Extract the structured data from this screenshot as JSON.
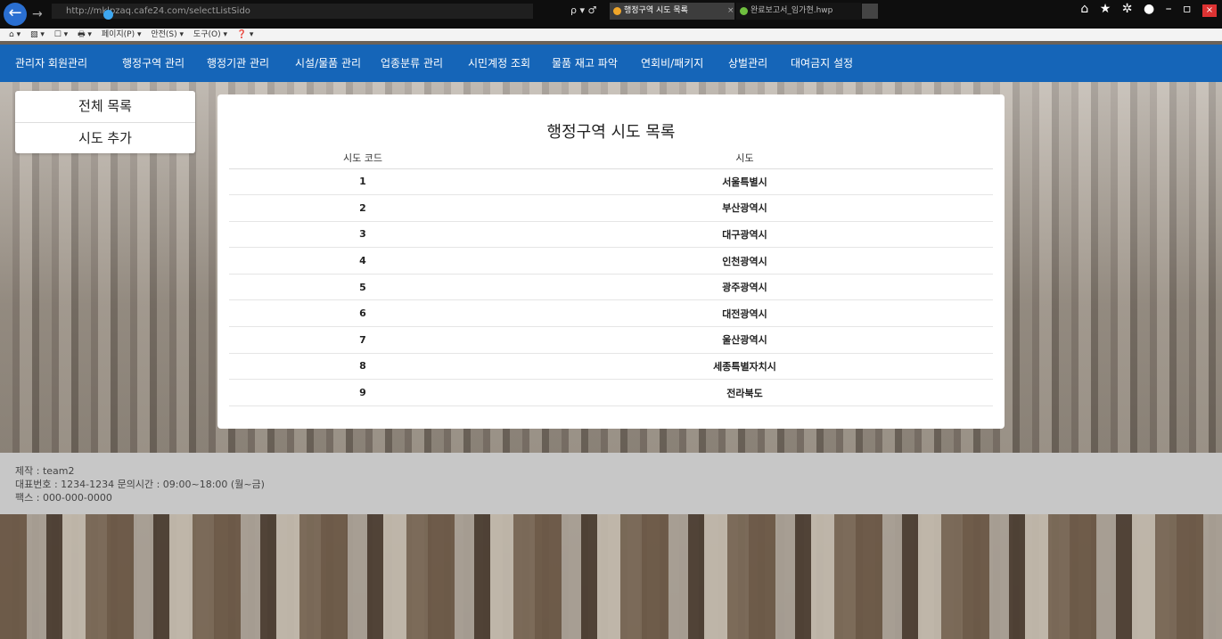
{
  "browser": {
    "url": "http://mklpzaq.cafe24.com/selectListSido",
    "addr_tools": "ρ ▾ ♂",
    "tabs": [
      {
        "label": "행정구역 시도 목록",
        "close": "×"
      },
      {
        "label": "완료보고서_임가현.hwp",
        "close": ""
      }
    ],
    "cmdbar": [
      "⌂ ▾",
      "▧ ▾",
      "☐ ▾",
      "🖶 ▾",
      "페이지(P) ▾",
      "안전(S) ▾",
      "도구(O) ▾",
      "❓ ▾"
    ],
    "window_controls": "⌂ ★ ✲ ●  –  ▫",
    "close_glyph": "×"
  },
  "nav": {
    "items": [
      "관리자 회원관리",
      "행정구역 관리",
      "행정기관 관리",
      "시설/물품 관리",
      "업종분류 관리",
      "시민계정 조회",
      "물품 재고 파악",
      "연회비/패키지",
      "상벌관리",
      "대여금지 설정"
    ]
  },
  "sidebar": {
    "items": [
      "전체 목록",
      "시도 추가"
    ]
  },
  "main": {
    "title": "행정구역 시도 목록",
    "headers": [
      "시도 코드",
      "시도"
    ],
    "rows": [
      [
        "1",
        "서울특별시"
      ],
      [
        "2",
        "부산광역시"
      ],
      [
        "3",
        "대구광역시"
      ],
      [
        "4",
        "인천광역시"
      ],
      [
        "5",
        "광주광역시"
      ],
      [
        "6",
        "대전광역시"
      ],
      [
        "7",
        "울산광역시"
      ],
      [
        "8",
        "세종특별자치시"
      ],
      [
        "9",
        "전라북도"
      ]
    ]
  },
  "footer": {
    "line1": "제작 : team2",
    "line2": "대표번호 : 1234-1234 문의시간 : 09:00~18:00 (월~금)",
    "line3": "팩스 : 000-000-0000"
  }
}
